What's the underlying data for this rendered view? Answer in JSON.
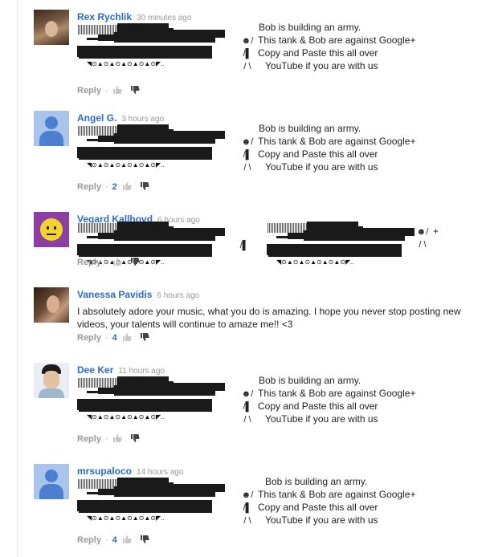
{
  "comments": [
    {
      "author": "Rex Rychlik",
      "time": "30 minutes ago",
      "avatar": "photo1",
      "kind": "tank",
      "lines": [
        "Bob is building an army.",
        "This tank & Bob are against Google+",
        "Copy and Paste this all over",
        "YouTube if you are with us"
      ],
      "figures": [
        "",
        "☻/",
        "/▌",
        "/ \\"
      ],
      "reply": "Reply",
      "likes": ""
    },
    {
      "author": "Angel G.",
      "time": "3 hours ago",
      "avatar": "default",
      "kind": "tank",
      "lines": [
        "Bob is building an army.",
        "This tank & Bob are against Google+",
        "Copy and Paste this all over",
        "YouTube if you are with us"
      ],
      "figures": [
        "",
        "☻/",
        "/▌",
        "/ \\"
      ],
      "reply": "Reply",
      "likes": "2"
    },
    {
      "author": "Vegard Kallhovd",
      "time": "6 hours ago",
      "avatar": "smiley",
      "kind": "double-tank",
      "figures": [
        "☻/",
        "/▌",
        "/ \\"
      ],
      "plus": "+",
      "reply": "Reply",
      "likes": ""
    },
    {
      "author": "Vanessa Pavidis",
      "time": "6 hours ago",
      "avatar": "photo2",
      "kind": "text",
      "text": "I absolutely adore your music, what you do is amazing. I hope you never stop posting new videos, your talents will continue to amaze me!! <3",
      "reply": "Reply",
      "likes": "4"
    },
    {
      "author": "Dee Ker",
      "time": "11 hours ago",
      "avatar": "photo3",
      "kind": "tank",
      "lines": [
        "Bob is building an army.",
        "This tank & Bob are against Google+",
        "Copy and Paste this all over",
        "YouTube if you are with us"
      ],
      "figures": [
        "",
        "☻/",
        "/▌",
        "/ \\"
      ],
      "reply": "Reply",
      "likes": ""
    },
    {
      "author": "mrsupaloco",
      "time": "14 hours ago",
      "avatar": "default",
      "kind": "tank",
      "lines": [
        "Bob is building an army.",
        "This tank & Bob are against Google+",
        "Copy and Paste this all over",
        "YouTube if you are with us"
      ],
      "figures": [
        "",
        "☻/",
        "/▌",
        "/ \\"
      ],
      "reply": "Reply",
      "likes": "4"
    }
  ],
  "wheels": "◥⊙▲⊙▲⊙▲⊙▲⊙▲⊙◤..",
  "icons": {
    "like": "thumbs-up-icon",
    "dislike": "thumbs-down-icon"
  }
}
